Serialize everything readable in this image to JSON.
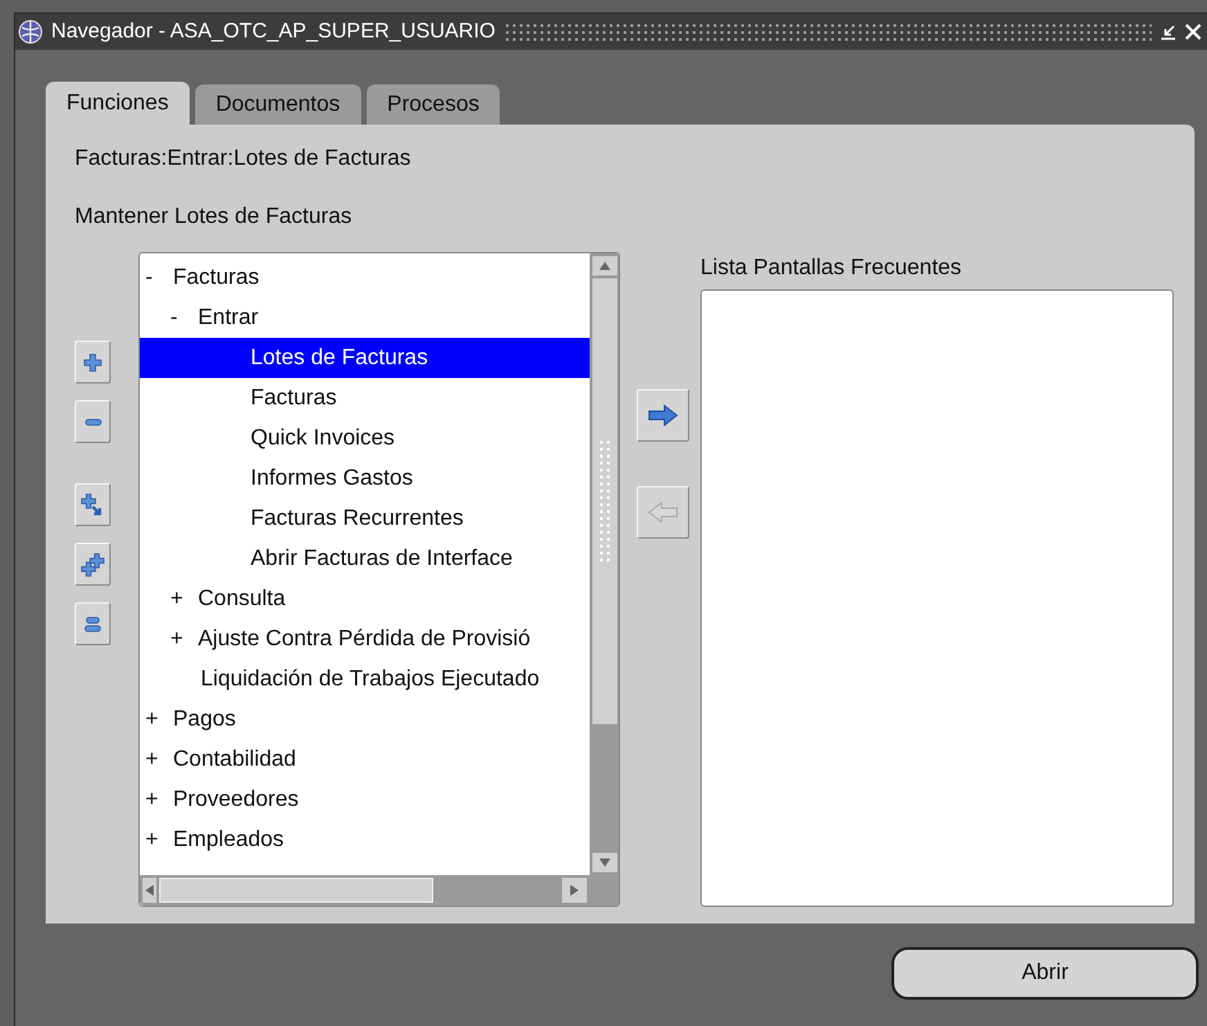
{
  "window": {
    "title": "Navegador - ASA_OTC_AP_SUPER_USUARIO"
  },
  "tabs": [
    {
      "label": "Funciones",
      "selected": true
    },
    {
      "label": "Documentos",
      "selected": false
    },
    {
      "label": "Procesos",
      "selected": false
    }
  ],
  "path": "Facturas:Entrar:Lotes de Facturas",
  "heading": "Mantener Lotes de Facturas",
  "tree_tools": [
    {
      "kind": "expand"
    },
    {
      "kind": "collapse"
    },
    {
      "kind": "expand_branch"
    },
    {
      "kind": "expand_all"
    },
    {
      "kind": "collapse_all"
    }
  ],
  "tree": [
    {
      "toggle": "-",
      "label": "Facturas",
      "selected": false,
      "children": [
        {
          "toggle": "-",
          "label": "Entrar",
          "selected": false,
          "children": [
            {
              "label": "Lotes de Facturas",
              "selected": true
            },
            {
              "label": "Facturas",
              "selected": false
            },
            {
              "label": "Quick Invoices",
              "selected": false
            },
            {
              "label": "Informes Gastos",
              "selected": false
            },
            {
              "label": "Facturas Recurrentes",
              "selected": false
            },
            {
              "label": "Abrir Facturas de Interface",
              "selected": false
            }
          ]
        },
        {
          "toggle": "+",
          "label": "Consulta",
          "selected": false
        },
        {
          "toggle": "+",
          "label": "Ajuste Contra Pérdida de Provisió",
          "selected": false
        },
        {
          "label": "Liquidación de Trabajos Ejecutado",
          "selected": false
        }
      ]
    },
    {
      "toggle": "+",
      "label": "Pagos",
      "selected": false
    },
    {
      "toggle": "+",
      "label": "Contabilidad",
      "selected": false
    },
    {
      "toggle": "+",
      "label": "Proveedores",
      "selected": false
    },
    {
      "toggle": "+",
      "label": "Empleados",
      "selected": false
    }
  ],
  "transfer_buttons": [
    {
      "kind": "add",
      "disabled": false
    },
    {
      "kind": "remove",
      "disabled": true
    }
  ],
  "frequent_list": {
    "label": "Lista Pantallas Frecuentes"
  },
  "buttons": [
    {
      "label": "Abrir"
    }
  ]
}
